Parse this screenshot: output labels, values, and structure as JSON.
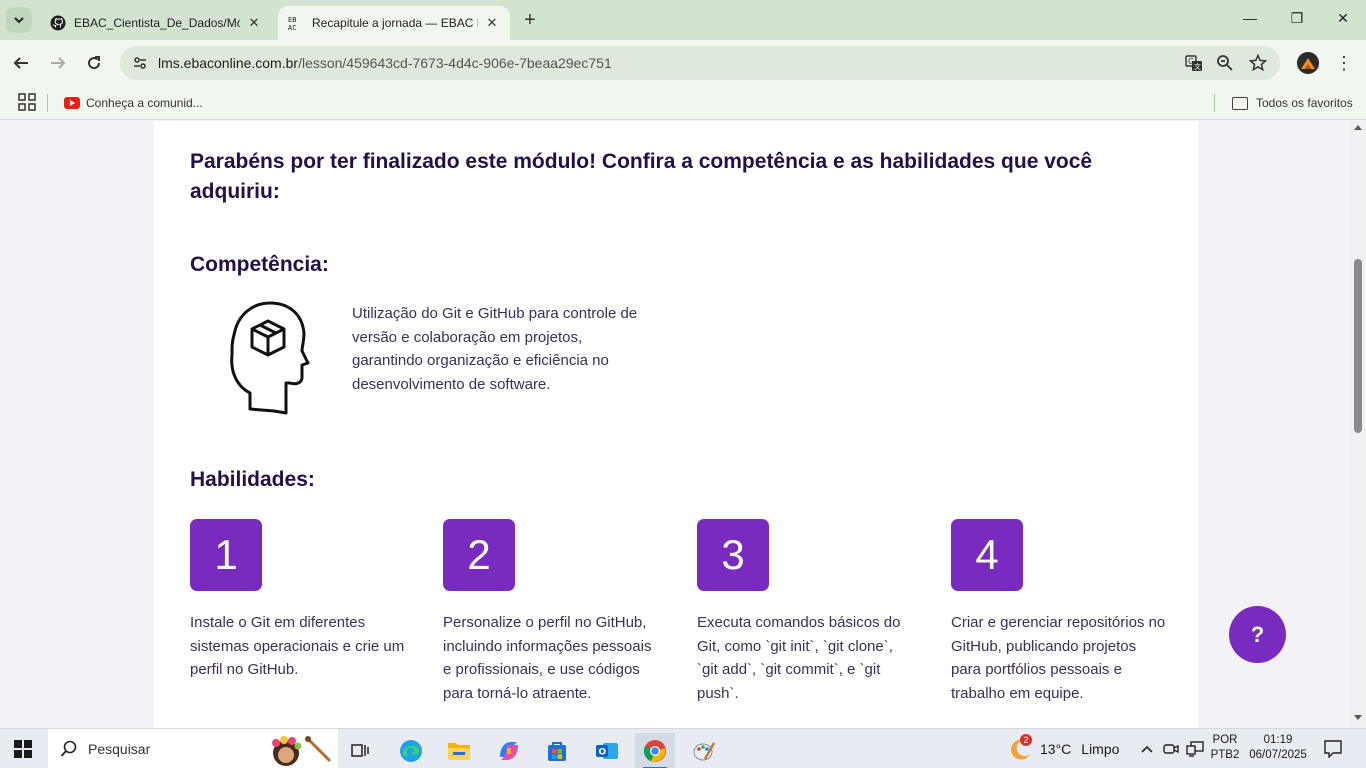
{
  "browser": {
    "tabs": [
      {
        "title": "EBAC_Cientista_De_Dados/Módulo",
        "favicon": "github-icon",
        "active": false
      },
      {
        "title": "Recapitule a jornada — EBAC LMS",
        "favicon": "ebac-icon",
        "active": true
      }
    ],
    "url_host": "lms.ebaconline.com.br",
    "url_path": "/lesson/459643cd-7673-4d4c-906e-7beaa29ec751",
    "bookmarks": [
      {
        "label": "Conheça a comunid..."
      }
    ],
    "all_bookmarks_label": "Todos os favoritos"
  },
  "page": {
    "heading": "Parabéns por ter finalizado este módulo! Confira a competência e as habilidades que você adquiriu:",
    "competence_title": "Competência:",
    "competence_text": "Utilização do Git e GitHub para controle de versão e colaboração em projetos, garantindo organização e eficiência no desenvolvimento de software.",
    "skills_title": "Habilidades:",
    "skills": [
      {
        "number": "1",
        "text": "Instale o Git em diferentes sistemas operacionais e crie um perfil no GitHub."
      },
      {
        "number": "2",
        "text": "Personalize o perfil no GitHub, incluindo informações pessoais e profissionais, e use códigos para torná-lo atraente."
      },
      {
        "number": "3",
        "text": "Executa comandos básicos do Git, como `git init`, `git clone`, `git add`, `git commit`, e `git push`."
      },
      {
        "number": "4",
        "text": "Criar e gerenciar repositórios no GitHub, publicando projetos para portfólios pessoais e trabalho em equipe."
      }
    ],
    "help_label": "?"
  },
  "taskbar": {
    "search_placeholder": "Pesquisar",
    "weather_temp": "13°C",
    "weather_desc": "Limpo",
    "weather_badge": "2",
    "lang_1": "POR",
    "lang_2": "PTB2",
    "time": "01:19",
    "date": "06/07/2025"
  },
  "colors": {
    "accent": "#7a2bbf",
    "heading": "#23104a",
    "chrome": "#d3e3cf"
  }
}
